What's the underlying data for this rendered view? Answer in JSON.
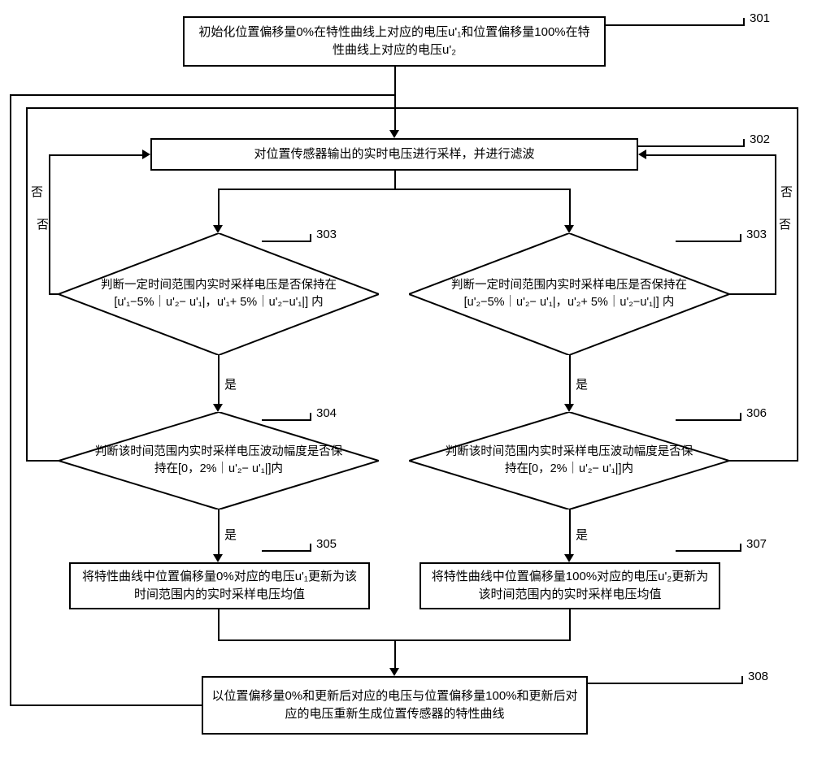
{
  "step301": "初始化位置偏移量0%在特性曲线上对应的电压u'₁和位置偏移量100%在特性曲线上对应的电压u'₂",
  "step302": "对位置传感器输出的实时电压进行采样，并进行滤波",
  "step303_left": "判断一定时间范围内实时采样电压是否保持在[u'₁−5%｜u'₂− u'₁|，u'₁+ 5%｜u'₂−u'₁|] 内",
  "step303_right": "判断一定时间范围内实时采样电压是否保持在[u'₂−5%｜u'₂− u'₁|，u'₂+ 5%｜u'₂−u'₁|] 内",
  "step304": "判断该时间范围内实时采样电压波动幅度是否保持在[0，2%｜u'₂− u'₁|]内",
  "step306": "判断该时间范围内实时采样电压波动幅度是否保持在[0，2%｜u'₂− u'₁|]内",
  "step305": "将特性曲线中位置偏移量0%对应的电压u'₁更新为该时间范围内的实时采样电压均值",
  "step307": "将特性曲线中位置偏移量100%对应的电压u'₂更新为该时间范围内的实时采样电压均值",
  "step308": "以位置偏移量0%和更新后对应的电压与位置偏移量100%和更新后对应的电压重新生成位置传感器的特性曲线",
  "ref301": "301",
  "ref302": "302",
  "ref303a": "303",
  "ref303b": "303",
  "ref304": "304",
  "ref305": "305",
  "ref306": "306",
  "ref307": "307",
  "ref308": "308",
  "yes": "是",
  "no": "否"
}
